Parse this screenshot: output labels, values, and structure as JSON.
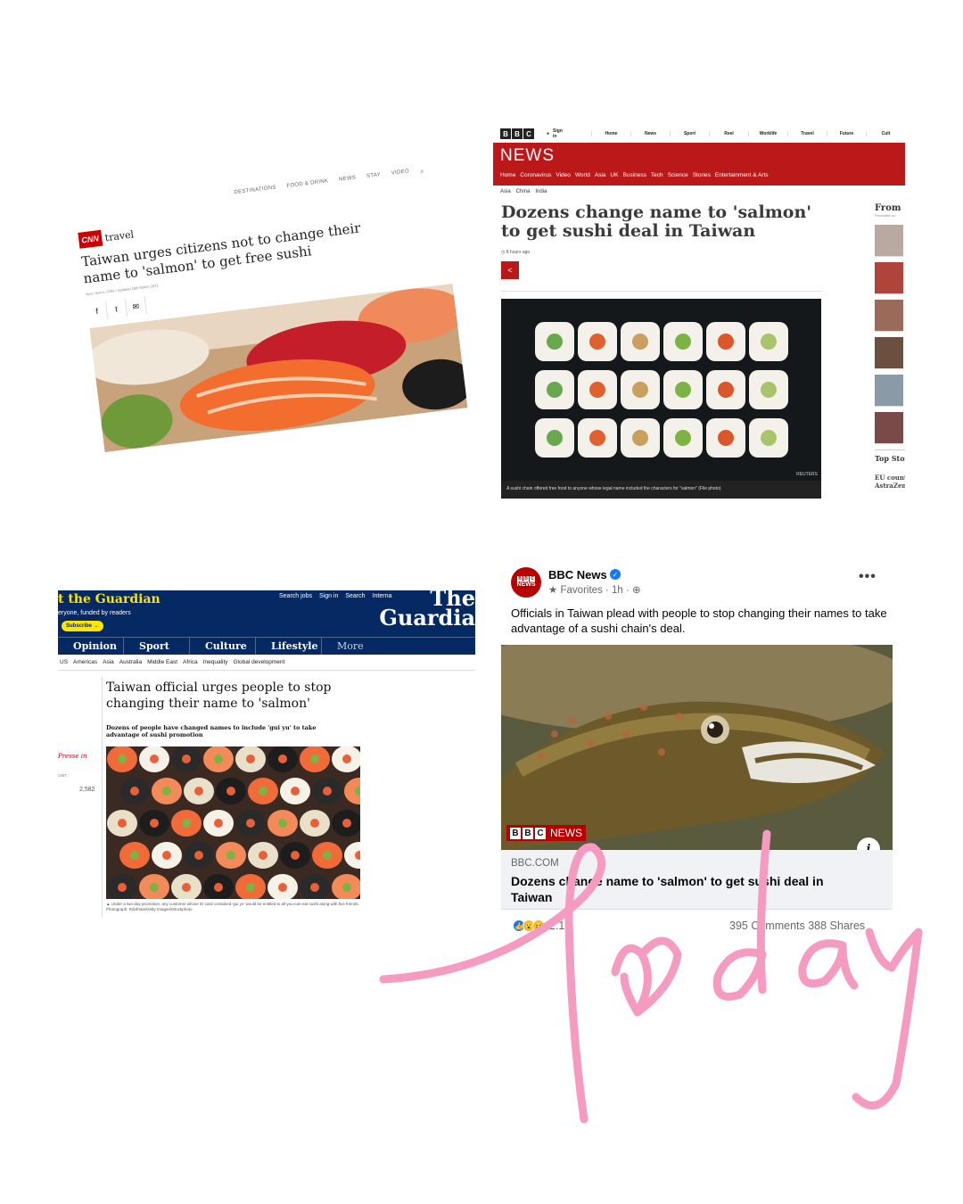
{
  "cnn": {
    "nav": [
      "DESTINATIONS",
      "FOOD & DRINK",
      "NEWS",
      "STAY",
      "VIDEO"
    ],
    "logo": "CNN",
    "section": "travel",
    "headline": "Taiwan urges citizens not to change their name to 'salmon' to get free sushi",
    "byline": "Yoon Jeon's, CNN • Updated 18th March 2021",
    "share": [
      "f",
      "t",
      "✉"
    ]
  },
  "bbc_web": {
    "logo_letters": [
      "B",
      "B",
      "C"
    ],
    "signin": "Sign in",
    "topnav": [
      "Home",
      "News",
      "Sport",
      "Reel",
      "Worklife",
      "Travel",
      "Future",
      "Cult"
    ],
    "masthead": "NEWS",
    "sections": [
      "Home",
      "Coronavirus",
      "Video",
      "World",
      "Asia",
      "UK",
      "Business",
      "Tech",
      "Science",
      "Stories",
      "Entertainment & Arts"
    ],
    "subnav": [
      "Asia",
      "China",
      "India"
    ],
    "headline": "Dozens change name to 'salmon' to get sushi deal in Taiwan",
    "time": "8 hours ago",
    "photo_credit": "REUTERS",
    "caption": "A sushi chain offered free food to anyone whose legal name included the characters for \"salmon\" (File photo)",
    "sidebar_title": "From",
    "sidebar_promo": "Promoted co",
    "top_stories": "Top Stor",
    "eu_story": "EU count\nAstraZen"
  },
  "guardian": {
    "support": "t the Guardian",
    "funded": "eryone, funded by readers",
    "subscribe": "Subscribe →",
    "util": [
      "Search jobs",
      "Sign in",
      "Search",
      "Interna"
    ],
    "brand_line1": "The",
    "brand_line2": "Guardia",
    "nav": [
      "Opinion",
      "Sport",
      "Culture",
      "Lifestyle",
      "More"
    ],
    "subnav": [
      "US",
      "Americas",
      "Asia",
      "Australia",
      "Middle East",
      "Africa",
      "Inequality",
      "Global development"
    ],
    "headline": "Taiwan official urges people to stop changing their name to 'salmon'",
    "standfirst": "Dozens of people have changed names to include 'gui yu' to take advantage of sushi promotion",
    "presse": "Presse in",
    "gmt": "GMT",
    "shares": "2,582",
    "caption": "▲ Under a two-day promotion, any customer whose ID card contained 'gui yu' would be entitled to all-you-can-eat sushi along with five friends. Photograph: Rdofrtais/Getty Images/iStockphoto"
  },
  "facebook": {
    "page_name": "BBC News",
    "meta": "★ Favorites · 1h · ⊕",
    "post_text": "Officials in Taiwan plead with people to stop changing their names to take advantage of a sushi chain's deal.",
    "watermark_letters": [
      "B",
      "B",
      "C"
    ],
    "watermark_word": "NEWS",
    "domain": "BBC.COM",
    "link_title": "Dozens change name to 'salmon' to get sushi deal in Taiwan",
    "reaction_count": "2.1K",
    "stats": "395 Comments  388 Shares"
  },
  "overlay": {
    "handwriting": "Today",
    "color": "#f59ac0"
  }
}
